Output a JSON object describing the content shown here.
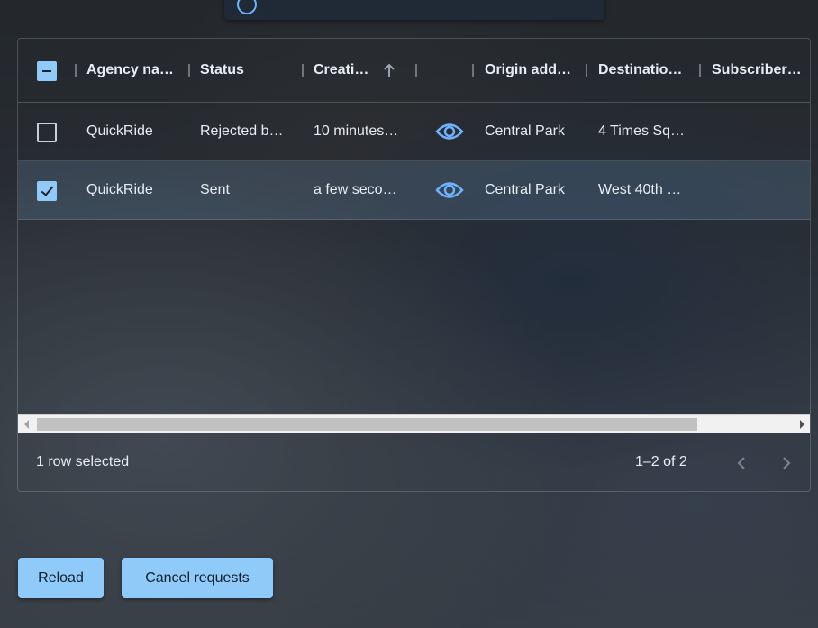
{
  "colors": {
    "accent": "#90caf9",
    "surface_text": "#e8edf3"
  },
  "snackbar": {
    "icon": "info-icon",
    "text": ""
  },
  "table": {
    "columns": [
      {
        "label": "Agency na…"
      },
      {
        "label": "Status"
      },
      {
        "label": "Creati…",
        "sort": "ascending",
        "sort_icon": "arrow-up-icon"
      },
      {
        "label": ""
      },
      {
        "label": "Origin addr…"
      },
      {
        "label": "Destinatio…"
      },
      {
        "label": "Subscriber…"
      }
    ],
    "header_checkbox": "indeterminate",
    "rows": [
      {
        "selected": false,
        "agency": "QuickRide",
        "status": "Rejected b…",
        "created": "10 minutes…",
        "icon": "eye-icon",
        "origin": "Central Park",
        "destination": "4 Times Sq…",
        "subscriber": ""
      },
      {
        "selected": true,
        "agency": "QuickRide",
        "status": "Sent",
        "created": "a few seco…",
        "icon": "eye-icon",
        "origin": "Central Park",
        "destination": "West 40th …",
        "subscriber": ""
      }
    ]
  },
  "footer": {
    "selected_text": "1 row selected",
    "pagination_text": "1–2 of 2",
    "prev_icon": "chevron-left-icon",
    "next_icon": "chevron-right-icon"
  },
  "actions": {
    "reload_label": "Reload",
    "cancel_label": "Cancel requests"
  }
}
